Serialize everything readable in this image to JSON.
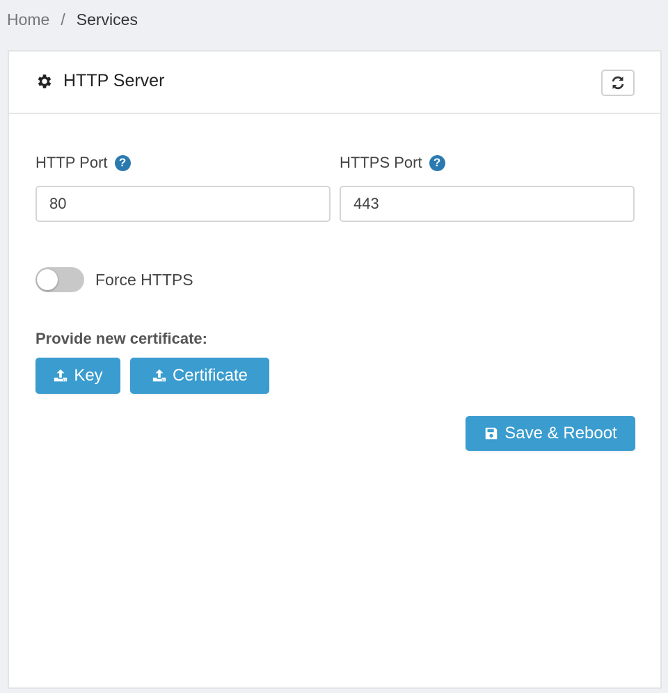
{
  "breadcrumb": {
    "home": "Home",
    "separator": "/",
    "current": "Services"
  },
  "card": {
    "title": "HTTP Server",
    "title_icon": "gear-icon",
    "refresh_icon": "refresh-icon"
  },
  "form": {
    "http_port": {
      "label": "HTTP Port",
      "value": "80",
      "help_icon": "question-circle-icon"
    },
    "https_port": {
      "label": "HTTPS Port",
      "value": "443",
      "help_icon": "question-circle-icon"
    },
    "force_https": {
      "label": "Force HTTPS",
      "enabled": false
    },
    "certificate": {
      "label": "Provide new certificate:",
      "key_button": "Key",
      "cert_button": "Certificate",
      "upload_icon": "upload-icon"
    },
    "save_button": "Save & Reboot",
    "save_icon": "floppy-disk-icon"
  },
  "colors": {
    "accent": "#3a9ccf",
    "help_icon": "#2a7ab0",
    "toggle_off": "#c8c8c8",
    "background": "#eef0f4"
  }
}
